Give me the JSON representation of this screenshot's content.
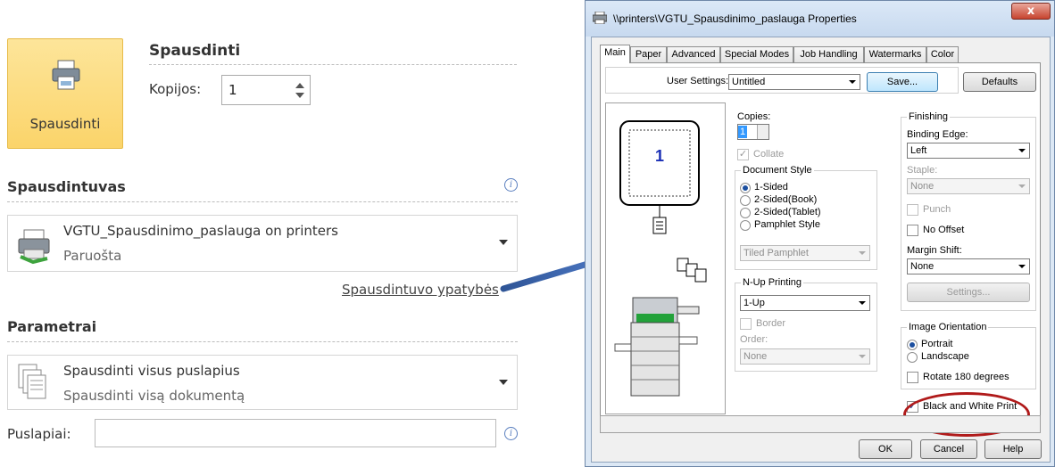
{
  "backstage": {
    "print_button_label": "Spausdinti",
    "print_heading": "Spausdinti",
    "copies_label": "Kopijos:",
    "copies_value": "1",
    "printer_heading": "Spausdintuvas",
    "printer_name": "VGTU_Spausdinimo_paslauga on printers",
    "printer_status": "Paruošta",
    "printer_properties_link": "Spausdintuvo ypatybės",
    "settings_heading": "Parametrai",
    "print_range_title": "Spausdinti visus puslapius",
    "print_range_subtitle": "Spausdinti visą dokumentą",
    "pages_label": "Puslapiai:",
    "pages_value": ""
  },
  "dialog": {
    "title": "\\\\printers\\VGTU_Spausdinimo_paslauga Properties",
    "close_label": "x",
    "tabs": [
      "Main",
      "Paper",
      "Advanced",
      "Special Modes",
      "Job Handling",
      "Watermarks",
      "Color"
    ],
    "active_tab": "Main",
    "user_settings_label": "User Settings:",
    "user_settings_value": "Untitled",
    "save_label": "Save...",
    "defaults_label": "Defaults",
    "preview_page_number": "1",
    "copies_label": "Copies:",
    "copies_value": "1",
    "collate_label": "Collate",
    "collate_checked": true,
    "document_style_label": "Document Style",
    "document_style_options": [
      "1-Sided",
      "2-Sided(Book)",
      "2-Sided(Tablet)",
      "Pamphlet Style"
    ],
    "document_style_selected": "1-Sided",
    "pamphlet_value": "Tiled Pamphlet",
    "nup_label": "N-Up Printing",
    "nup_value": "1-Up",
    "border_label": "Border",
    "order_label": "Order:",
    "order_value": "None",
    "finishing_label": "Finishing",
    "binding_edge_label": "Binding Edge:",
    "binding_edge_value": "Left",
    "staple_label": "Staple:",
    "staple_value": "None",
    "punch_label": "Punch",
    "no_offset_label": "No Offset",
    "margin_shift_label": "Margin Shift:",
    "margin_shift_value": "None",
    "settings_button_label": "Settings...",
    "image_orientation_label": "Image Orientation",
    "orientation_options": [
      "Portrait",
      "Landscape"
    ],
    "orientation_selected": "Portrait",
    "rotate_label": "Rotate 180 degrees",
    "bw_label": "Black and White Print",
    "bw_checked": true,
    "ok_label": "OK",
    "cancel_label": "Cancel",
    "help_label": "Help"
  },
  "colors": {
    "highlight_oval": "#b01a1a",
    "arrow": "#3b63a8",
    "print_button_bg": "#fbd46a"
  }
}
